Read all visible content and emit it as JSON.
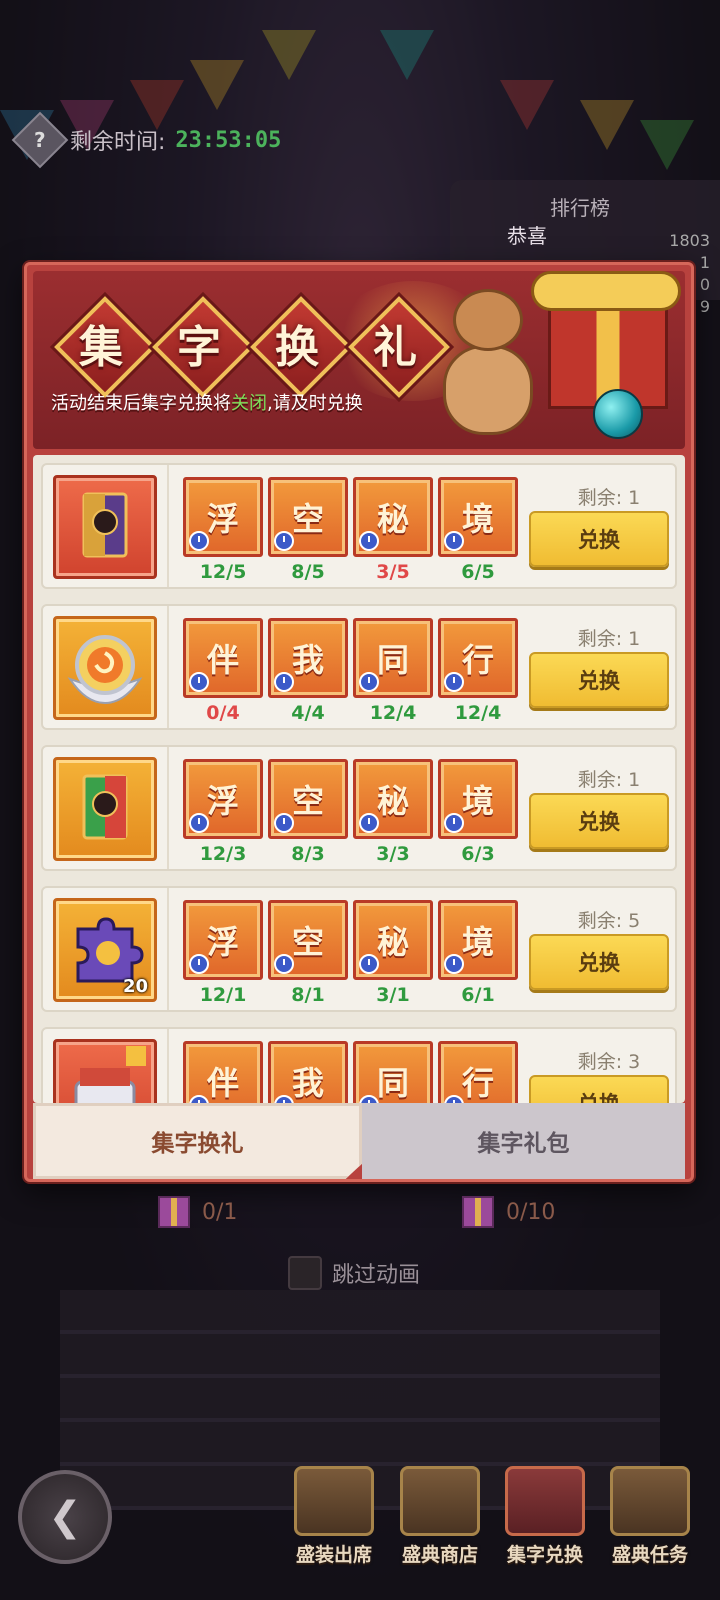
{
  "timer": {
    "label": "剩余时间:",
    "value": "23:53:05"
  },
  "ranking": {
    "title": "排行榜",
    "congrats": "恭喜",
    "numbers": [
      "1803",
      "1",
      "0",
      "9"
    ]
  },
  "banner": {
    "title_chars": [
      "集",
      "字",
      "换",
      "礼"
    ],
    "subtitle_pre": "活动结束后集字兑换将",
    "subtitle_highlight": "关闭",
    "subtitle_post": ",请及时兑换"
  },
  "rows": [
    {
      "remain": "剩余: 1",
      "button": "兑换",
      "reward_count": "",
      "tiles": [
        {
          "ch": "浮",
          "count": "12/5",
          "ok": true
        },
        {
          "ch": "空",
          "count": "8/5",
          "ok": true
        },
        {
          "ch": "秘",
          "count": "3/5",
          "ok": false
        },
        {
          "ch": "境",
          "count": "6/5",
          "ok": true
        }
      ]
    },
    {
      "remain": "剩余: 1",
      "button": "兑换",
      "reward_count": "",
      "tiles": [
        {
          "ch": "伴",
          "count": "0/4",
          "ok": false
        },
        {
          "ch": "我",
          "count": "4/4",
          "ok": true
        },
        {
          "ch": "同",
          "count": "12/4",
          "ok": true
        },
        {
          "ch": "行",
          "count": "12/4",
          "ok": true
        }
      ]
    },
    {
      "remain": "剩余: 1",
      "button": "兑换",
      "reward_count": "",
      "tiles": [
        {
          "ch": "浮",
          "count": "12/3",
          "ok": true
        },
        {
          "ch": "空",
          "count": "8/3",
          "ok": true
        },
        {
          "ch": "秘",
          "count": "3/3",
          "ok": true
        },
        {
          "ch": "境",
          "count": "6/3",
          "ok": true
        }
      ]
    },
    {
      "remain": "剩余: 5",
      "button": "兑换",
      "reward_count": "20",
      "tiles": [
        {
          "ch": "浮",
          "count": "12/1",
          "ok": true
        },
        {
          "ch": "空",
          "count": "8/1",
          "ok": true
        },
        {
          "ch": "秘",
          "count": "3/1",
          "ok": true
        },
        {
          "ch": "境",
          "count": "6/1",
          "ok": true
        }
      ]
    },
    {
      "remain": "剩余: 3",
      "button": "兑换",
      "reward_count": "",
      "tiles": [
        {
          "ch": "伴",
          "count": "",
          "ok": true
        },
        {
          "ch": "我",
          "count": "",
          "ok": true
        },
        {
          "ch": "同",
          "count": "",
          "ok": true
        },
        {
          "ch": "行",
          "count": "",
          "ok": true
        }
      ]
    }
  ],
  "tabs": [
    {
      "label": "集字换礼",
      "active": true
    },
    {
      "label": "集字礼包",
      "active": false
    }
  ],
  "bottom": {
    "left_count": "0/1",
    "right_count": "0/10",
    "skip_label": "跳过动画"
  },
  "nav": [
    {
      "label": "盛装出席",
      "active": false
    },
    {
      "label": "盛典商店",
      "active": false
    },
    {
      "label": "集字兑换",
      "active": true
    },
    {
      "label": "盛典任务",
      "active": false
    }
  ],
  "colors": {
    "ok": "#2f9a3e",
    "bad": "#e04848",
    "timer": "#4cb35c"
  }
}
